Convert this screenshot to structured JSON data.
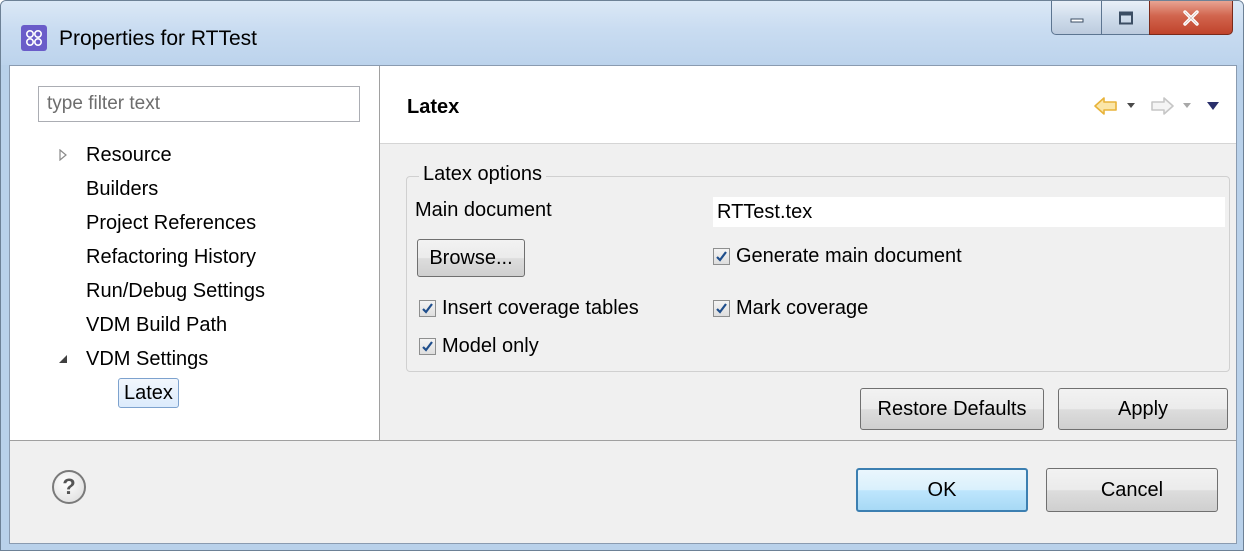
{
  "window": {
    "title": "Properties for RTTest"
  },
  "sidebar": {
    "filter_placeholder": "type filter text",
    "items": [
      {
        "label": "Resource",
        "expanded": false
      },
      {
        "label": "Builders"
      },
      {
        "label": "Project References"
      },
      {
        "label": "Refactoring History"
      },
      {
        "label": "Run/Debug Settings"
      },
      {
        "label": "VDM Build Path"
      },
      {
        "label": "VDM Settings",
        "expanded": true
      },
      {
        "label": "Latex",
        "selected": true
      }
    ]
  },
  "page": {
    "title": "Latex",
    "group_title": "Latex options",
    "main_document_label": "Main document",
    "main_document_value": "RTTest.tex",
    "browse_label": "Browse...",
    "options": {
      "generate_main_document": {
        "label": "Generate main document",
        "checked": true
      },
      "insert_coverage_tables": {
        "label": "Insert coverage tables",
        "checked": true
      },
      "mark_coverage": {
        "label": "Mark coverage",
        "checked": true
      },
      "model_only": {
        "label": "Model only",
        "checked": true
      }
    },
    "restore_defaults_label": "Restore Defaults",
    "apply_label": "Apply"
  },
  "footer": {
    "help_glyph": "?",
    "ok_label": "OK",
    "cancel_label": "Cancel"
  },
  "colors": {
    "nav_back_arrow": "#e8b33a",
    "checkmark": "#1f4e8c",
    "selection_border": "#7da2ce"
  }
}
